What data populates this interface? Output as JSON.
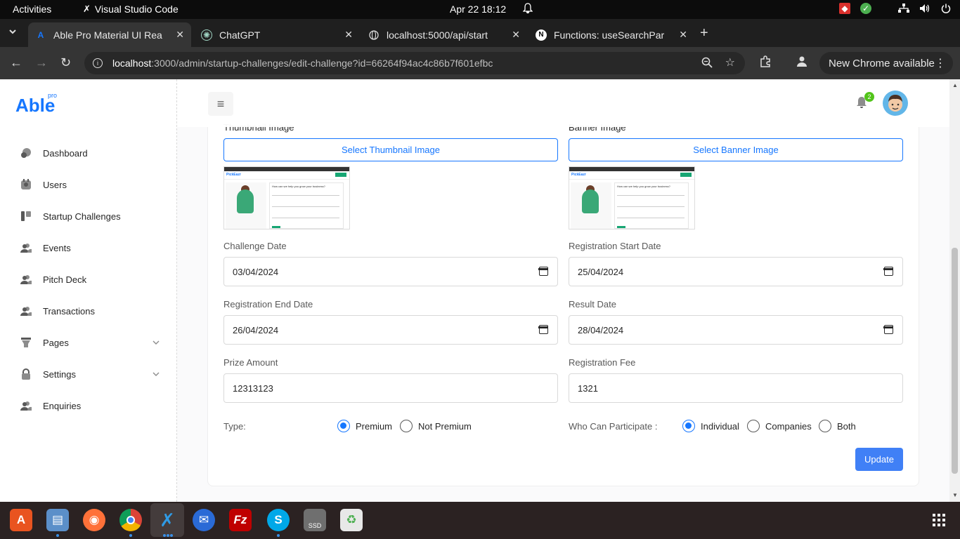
{
  "system": {
    "activities": "Activities",
    "app_name": "Visual Studio Code",
    "clock": "Apr 22  18:12"
  },
  "browser": {
    "tabs": [
      {
        "title": "Able Pro Material UI Rea",
        "icon": "able-logo-icon"
      },
      {
        "title": "ChatGPT",
        "icon": "chatgpt-icon"
      },
      {
        "title": "localhost:5000/api/start",
        "icon": "globe-icon"
      },
      {
        "title": "Functions: useSearchPar",
        "icon": "nextjs-icon"
      }
    ],
    "url_host": "localhost",
    "url_rest": ":3000/admin/startup-challenges/edit-challenge?id=66264f94ac4c86b7f601efbc",
    "update_label": "New Chrome available"
  },
  "sidebar": {
    "logo": "Able",
    "logo_sup": "pro",
    "items": [
      {
        "label": "Dashboard",
        "icon": "dashboard-icon"
      },
      {
        "label": "Users",
        "icon": "users-icon"
      },
      {
        "label": "Startup Challenges",
        "icon": "challenges-icon"
      },
      {
        "label": "Events",
        "icon": "events-icon"
      },
      {
        "label": "Pitch Deck",
        "icon": "pitch-deck-icon"
      },
      {
        "label": "Transactions",
        "icon": "transactions-icon"
      },
      {
        "label": "Pages",
        "icon": "pages-icon"
      },
      {
        "label": "Settings",
        "icon": "settings-icon"
      },
      {
        "label": "Enquiries",
        "icon": "enquiries-icon"
      }
    ]
  },
  "header": {
    "notification_count": "2"
  },
  "form": {
    "thumbnail_label": "Thumbnail Image",
    "banner_label": "Banner Image",
    "thumbnail_button": "Select Thumbnail Image",
    "banner_button": "Select Banner Image",
    "thumbnail_brand": "PickEazr",
    "thumbnail_heading": "How can we help you grow your business?",
    "challenge_date_label": "Challenge Date",
    "challenge_date": "03/04/2024",
    "reg_start_label": "Registration Start Date",
    "reg_start": "25/04/2024",
    "reg_end_label": "Registration End Date",
    "reg_end": "26/04/2024",
    "result_date_label": "Result Date",
    "result_date": "28/04/2024",
    "prize_label": "Prize Amount",
    "prize": "12313123",
    "fee_label": "Registration Fee",
    "fee": "1321",
    "type_label": "Type:",
    "type_options": [
      "Premium",
      "Not Premium"
    ],
    "type_selected": "Premium",
    "participate_label": "Who Can Participate :",
    "participate_options": [
      "Individual",
      "Companies",
      "Both"
    ],
    "participate_selected": "Individual",
    "update_button": "Update"
  },
  "dock": {
    "apps": [
      "app-center-icon",
      "files-icon",
      "firefox-icon",
      "chrome-icon",
      "vscode-icon",
      "thunderbird-icon",
      "filezilla-icon",
      "skype-icon",
      "ssd-drive-icon",
      "trash-icon",
      "app-grid-icon"
    ],
    "ssd_label": "SSD"
  }
}
